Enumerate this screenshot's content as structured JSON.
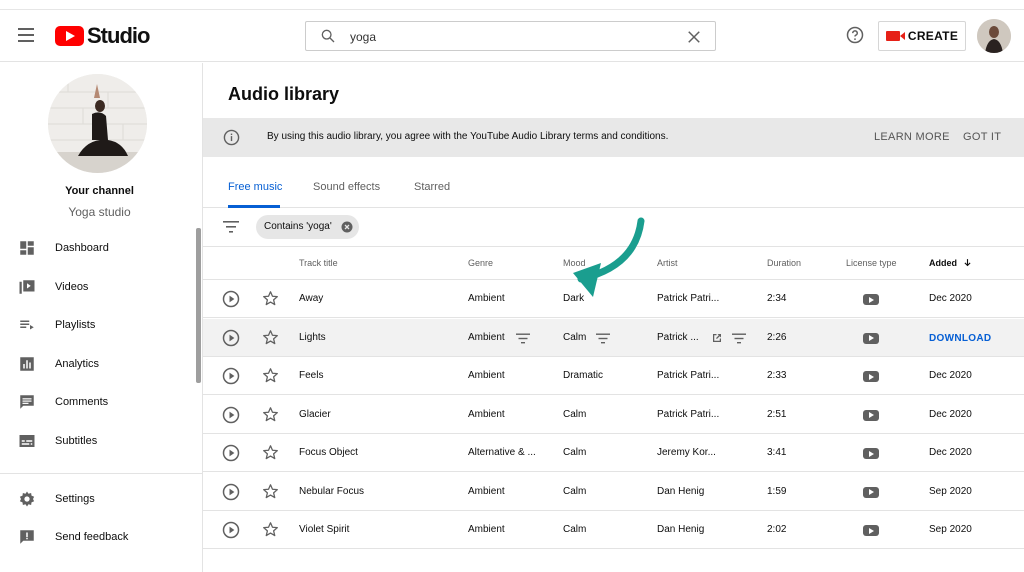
{
  "header": {
    "logo_text": "Studio",
    "search": {
      "value": "yoga"
    },
    "create_label": "CREATE"
  },
  "sidebar": {
    "your_channel": "Your channel",
    "channel_name": "Yoga studio",
    "items": [
      {
        "label": "Dashboard",
        "icon": "dashboard-icon"
      },
      {
        "label": "Videos",
        "icon": "videos-icon"
      },
      {
        "label": "Playlists",
        "icon": "playlists-icon"
      },
      {
        "label": "Analytics",
        "icon": "analytics-icon"
      },
      {
        "label": "Comments",
        "icon": "comments-icon"
      },
      {
        "label": "Subtitles",
        "icon": "subtitles-icon"
      }
    ],
    "bottom_items": [
      {
        "label": "Settings",
        "icon": "gear-icon"
      },
      {
        "label": "Send feedback",
        "icon": "feedback-icon"
      }
    ]
  },
  "main": {
    "title": "Audio library",
    "notice": {
      "text": "By using this audio library, you agree with the YouTube Audio Library terms and conditions.",
      "learn_more": "LEARN MORE",
      "got_it": "GOT IT"
    },
    "tabs": [
      {
        "label": "Free music",
        "active": true
      },
      {
        "label": "Sound effects",
        "active": false
      },
      {
        "label": "Starred",
        "active": false
      }
    ],
    "filter_chip": "Contains 'yoga'",
    "columns": {
      "track_title": "Track title",
      "genre": "Genre",
      "mood": "Mood",
      "artist": "Artist",
      "duration": "Duration",
      "license_type": "License type",
      "added": "Added"
    },
    "download_label": "DOWNLOAD",
    "rows": [
      {
        "title": "Away",
        "genre": "Ambient",
        "mood": "Dark",
        "artist": "Patrick Patri...",
        "duration": "2:34",
        "added": "Dec 2020"
      },
      {
        "title": "Lights",
        "genre": "Ambient",
        "mood": "Calm",
        "artist": "Patrick ...",
        "duration": "2:26",
        "added": ""
      },
      {
        "title": "Feels",
        "genre": "Ambient",
        "mood": "Dramatic",
        "artist": "Patrick Patri...",
        "duration": "2:33",
        "added": "Dec 2020"
      },
      {
        "title": "Glacier",
        "genre": "Ambient",
        "mood": "Calm",
        "artist": "Patrick Patri...",
        "duration": "2:51",
        "added": "Dec 2020"
      },
      {
        "title": "Focus Object",
        "genre": "Alternative & ...",
        "mood": "Calm",
        "artist": "Jeremy Kor...",
        "duration": "3:41",
        "added": "Dec 2020"
      },
      {
        "title": "Nebular Focus",
        "genre": "Ambient",
        "mood": "Calm",
        "artist": "Dan Henig",
        "duration": "1:59",
        "added": "Sep 2020"
      },
      {
        "title": "Violet Spirit",
        "genre": "Ambient",
        "mood": "Calm",
        "artist": "Dan Henig",
        "duration": "2:02",
        "added": "Sep 2020"
      }
    ]
  },
  "colors": {
    "brand_red": "#ff0000",
    "link_blue": "#065fd4",
    "annotation_teal": "#1a9e8f",
    "notice_bg": "#e8e8e8"
  }
}
